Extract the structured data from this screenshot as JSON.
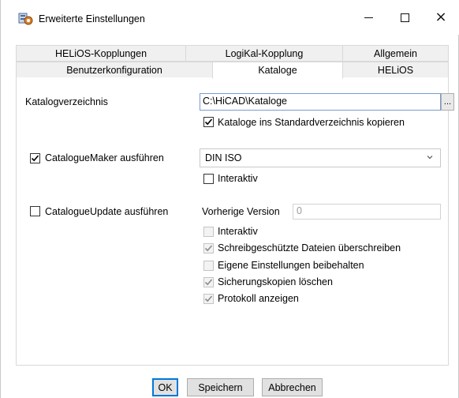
{
  "window": {
    "title": "Erweiterte Einstellungen",
    "controls": {
      "minimize": "minimize",
      "maximize": "maximize",
      "close": "×"
    }
  },
  "tabs": {
    "row1": [
      "HELiOS-Kopplungen",
      "LogiKal-Kopplung",
      "Allgemein"
    ],
    "row2": [
      "Benutzerkonfiguration",
      "Kataloge",
      "HELiOS"
    ],
    "active": "Kataloge"
  },
  "catalog": {
    "dir_label": "Katalogverzeichnis",
    "dir_value": "C:\\HiCAD\\Kataloge",
    "browse_label": "...",
    "copy_label": "Kataloge ins Standardverzeichnis kopieren",
    "copy_checked": true
  },
  "maker": {
    "label": "CatalogueMaker ausführen",
    "checked": true,
    "combo_value": "DIN ISO",
    "interactive_label": "Interaktiv",
    "interactive_checked": false
  },
  "update": {
    "label": "CatalogueUpdate ausführen",
    "checked": false,
    "prev_version_label": "Vorherige Version",
    "prev_version_value": "0",
    "options": [
      {
        "label": "Interaktiv",
        "checked": false
      },
      {
        "label": "Schreibgeschützte Dateien überschreiben",
        "checked": true
      },
      {
        "label": "Eigene Einstellungen beibehalten",
        "checked": false
      },
      {
        "label": "Sicherungskopien löschen",
        "checked": true
      },
      {
        "label": "Protokoll anzeigen",
        "checked": true
      }
    ]
  },
  "buttons": {
    "ok": "OK",
    "save": "Speichern",
    "cancel": "Abbrechen"
  },
  "colors": {
    "accent": "#0078d7",
    "disabled_text": "#9a9a9a",
    "tab_bg": "#f0f0f0"
  }
}
